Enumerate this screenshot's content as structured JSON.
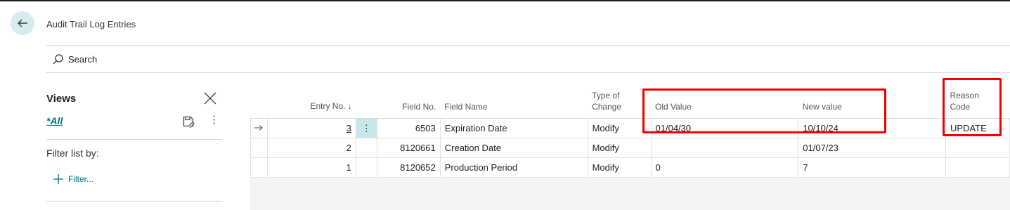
{
  "page": {
    "title": "Audit Trail Log Entries"
  },
  "search": {
    "label": "Search"
  },
  "views": {
    "title": "Views",
    "active_view": "*All",
    "filter_list_by": "Filter list by:",
    "add_filter_label": "Filter..."
  },
  "table": {
    "columns": {
      "entry_no": "Entry No.",
      "entry_no_sort": "↓",
      "field_no": "Field No.",
      "field_name": "Field Name",
      "type_of_change_line1": "Type of",
      "type_of_change_line2": "Change",
      "old_value": "Old Value",
      "new_value": "New value",
      "reason_code_line1": "Reason",
      "reason_code_line2": "Code"
    },
    "rows": [
      {
        "entry_no": "3",
        "field_no": "6503",
        "field_name": "Expiration Date",
        "type_of_change": "Modify",
        "old_value": "01/04/30",
        "new_value": "10/10/24",
        "reason_code": "UPDATE"
      },
      {
        "entry_no": "2",
        "field_no": "8120661",
        "field_name": "Creation Date",
        "type_of_change": "Modify",
        "old_value": "",
        "new_value": "01/07/23",
        "reason_code": ""
      },
      {
        "entry_no": "1",
        "field_no": "8120652",
        "field_name": "Production Period",
        "type_of_change": "Modify",
        "old_value": "0",
        "new_value": "7",
        "reason_code": ""
      }
    ]
  },
  "icons": {
    "back": "back-arrow-icon",
    "search": "search-icon",
    "close": "close-icon",
    "save_view": "save-view-icon",
    "more": "more-options-icon",
    "row_pointer": "row-pointer-arrow-icon",
    "add": "plus-icon"
  },
  "colors": {
    "accent": "#00757a",
    "back_button_bg": "#d7ecee",
    "selected_cell_bg": "#c6e8ea",
    "highlight_box": "#ee0000"
  }
}
